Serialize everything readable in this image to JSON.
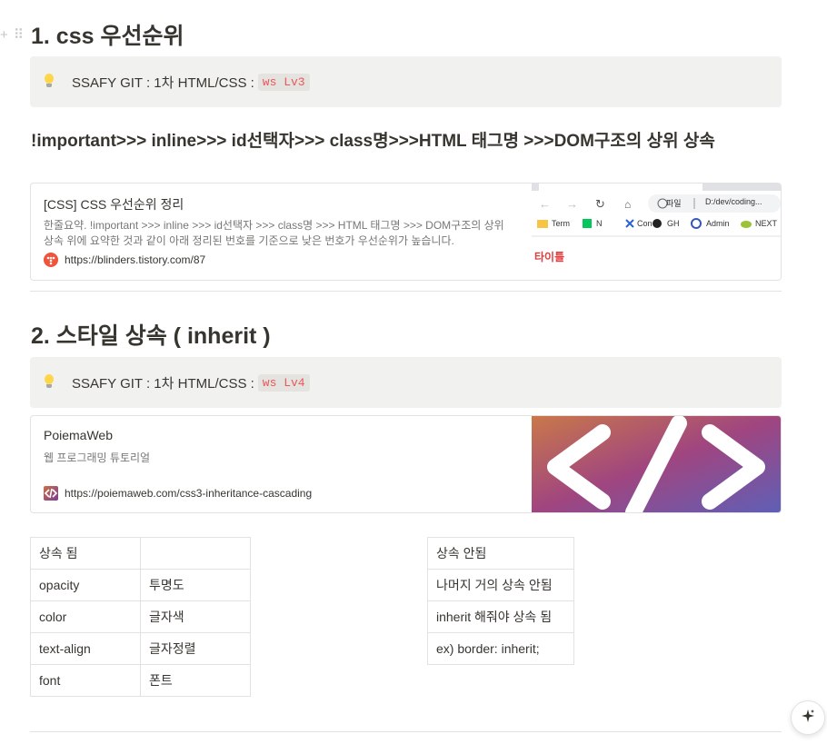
{
  "section1": {
    "heading": "1. css 우선순위",
    "callout_text": "SSAFY GIT : 1차 HTML/CSS : ",
    "callout_code": "ws Lv3",
    "subheading": "!important>>> inline>>> id선택자>>> class명>>>HTML 태그명 >>>DOM구조의 상위 상속",
    "bookmark": {
      "title": "[CSS] CSS 우선순위 정리",
      "description": "한줄요약. !important >>> inline >>> id선택자 >>> class명 >>> HTML 태그명 >>> DOM구조의 상위 상속 위에 요약한 것과 같이 아래 정리된 번호를 기준으로 낮은 번호가 우선순위가 높습니다.",
      "url": "https://blinders.tistory.com/87",
      "thumbnail": {
        "file_label": "파일",
        "address": "D:/dev/coding...",
        "bookmarks": [
          "Term",
          "N",
          "Con",
          "GH",
          "Admin",
          "NEXT"
        ],
        "caption": "타이틀"
      }
    }
  },
  "section2": {
    "heading": "2. 스타일 상속 ( inherit )",
    "callout_text": "SSAFY GIT : 1차 HTML/CSS : ",
    "callout_code": "ws Lv4",
    "bookmark": {
      "title": "PoiemaWeb",
      "description": "웹 프로그래밍 튜토리얼",
      "url": "https://poiemaweb.com/css3-inheritance-cascading"
    }
  },
  "table_inherited": [
    [
      "상속 됨",
      ""
    ],
    [
      "opacity",
      "투명도"
    ],
    [
      "color",
      "글자색"
    ],
    [
      "text-align",
      "글자정렬"
    ],
    [
      "font",
      "폰트"
    ]
  ],
  "table_not_inherited": [
    [
      "상속 안됨"
    ],
    [
      "나머지 거의 상속 안됨"
    ],
    [
      "inherit 해줘야 상속 됨"
    ],
    [
      "ex) border: inherit;"
    ]
  ],
  "colors": {
    "code_text": "#eb5757",
    "callout_bg": "#f1f1ef",
    "caption_red": "#e03e3e"
  },
  "icons": [
    "drag-handle-icon",
    "lightbulb-icon",
    "tistory-favicon",
    "poiemaweb-favicon",
    "sparkle-icon"
  ]
}
